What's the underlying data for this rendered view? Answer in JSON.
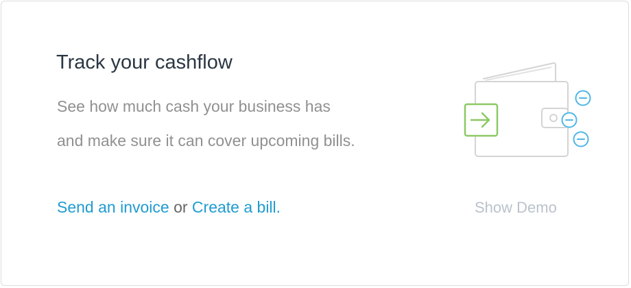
{
  "card": {
    "title": "Track your cashflow",
    "description_line1": "See how much cash your business has",
    "description_line2": "and make sure it can cover upcoming bills.",
    "actions": {
      "send_invoice": "Send an invoice",
      "or_text": "or",
      "create_bill": "Create a bill."
    },
    "show_demo": "Show Demo",
    "illustration": {
      "icon": "wallet-icon",
      "accent_green": "#8cc864",
      "accent_blue": "#4db6e8",
      "outline_gray": "#d4d4d4"
    }
  },
  "colors": {
    "title": "#2a3642",
    "body_text": "#909090",
    "link": "#1f9bd0",
    "muted": "#b9c2cb"
  }
}
